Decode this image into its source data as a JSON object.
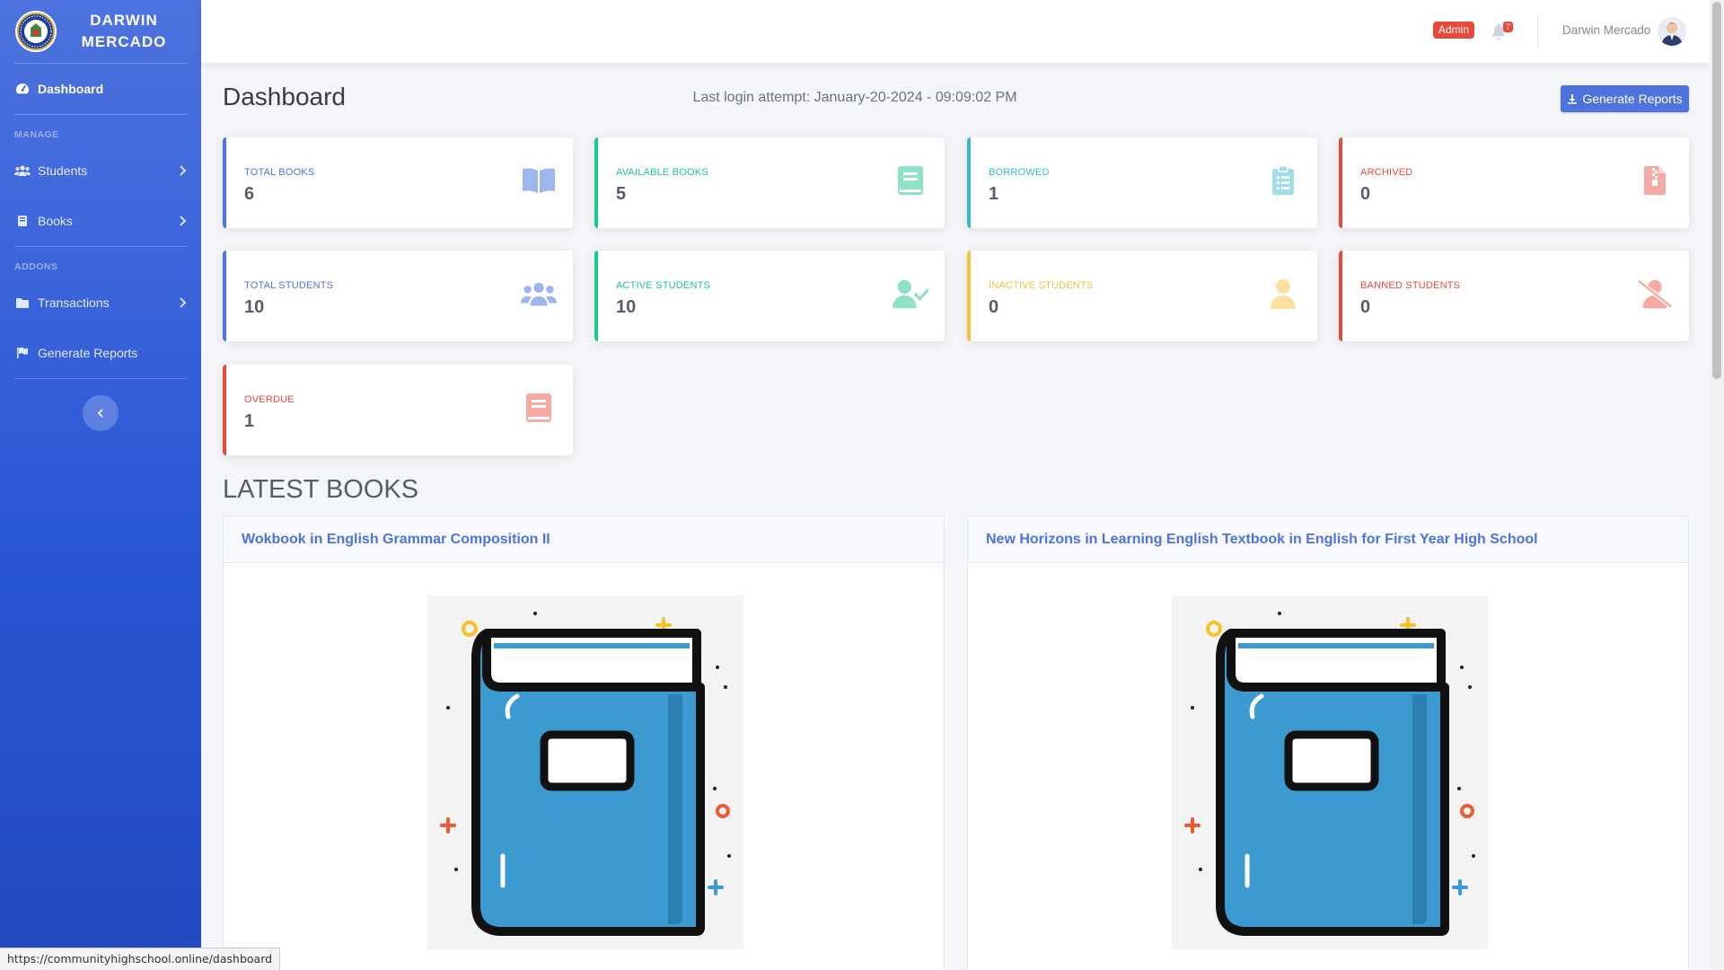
{
  "sidebar": {
    "brand": "DARWIN MERCADO",
    "items": {
      "dashboard": "Dashboard",
      "students": "Students",
      "books": "Books",
      "transactions": "Transactions",
      "generate_reports": "Generate Reports"
    },
    "headings": {
      "manage": "MANAGE",
      "addons": "ADDONS"
    },
    "icons": [
      "tachometer-icon",
      "users-icon",
      "book-icon",
      "folder-icon",
      "flag-icon",
      "chevron-right-icon",
      "chevron-left-icon"
    ]
  },
  "topbar": {
    "role_badge": "Admin",
    "notification_count": "7",
    "user_name": "Darwin Mercado"
  },
  "main": {
    "page_title": "Dashboard",
    "last_login": "Last login attempt: January-20-2024 - 09:09:02 PM",
    "generate_button": "Generate Reports",
    "stats": [
      {
        "label": "TOTAL BOOKS",
        "value": "6",
        "color": "#4e73df",
        "icon": "book-open-icon"
      },
      {
        "label": "AVAILABLE BOOKS",
        "value": "5",
        "color": "#1cc88a",
        "icon": "book-icon"
      },
      {
        "label": "BORROWED",
        "value": "1",
        "color": "#36b9cc",
        "icon": "clipboard-list-icon"
      },
      {
        "label": "ARCHIVED",
        "value": "0",
        "color": "#e74a3b",
        "icon": "file-archive-icon"
      },
      {
        "label": "TOTAL STUDENTS",
        "value": "10",
        "color": "#4e73df",
        "icon": "users-icon"
      },
      {
        "label": "ACTIVE STUDENTS",
        "value": "10",
        "color": "#1cc88a",
        "icon": "user-check-icon"
      },
      {
        "label": "INACTIVE STUDENTS",
        "value": "0",
        "color": "#f6c23e",
        "icon": "user-icon"
      },
      {
        "label": "BANNED STUDENTS",
        "value": "0",
        "color": "#e74a3b",
        "icon": "user-slash-icon"
      },
      {
        "label": "OVERDUE",
        "value": "1",
        "color": "#e74a3b",
        "icon": "book-icon"
      }
    ],
    "latest_books_title": "LATEST BOOKS",
    "latest_books": [
      {
        "title": "Wokbook in English Grammar Composition II"
      },
      {
        "title": "New Horizons in Learning English Textbook in English for First Year High School"
      }
    ]
  },
  "status_bar": {
    "url": "https://communityhighschool.online/dashboard"
  }
}
